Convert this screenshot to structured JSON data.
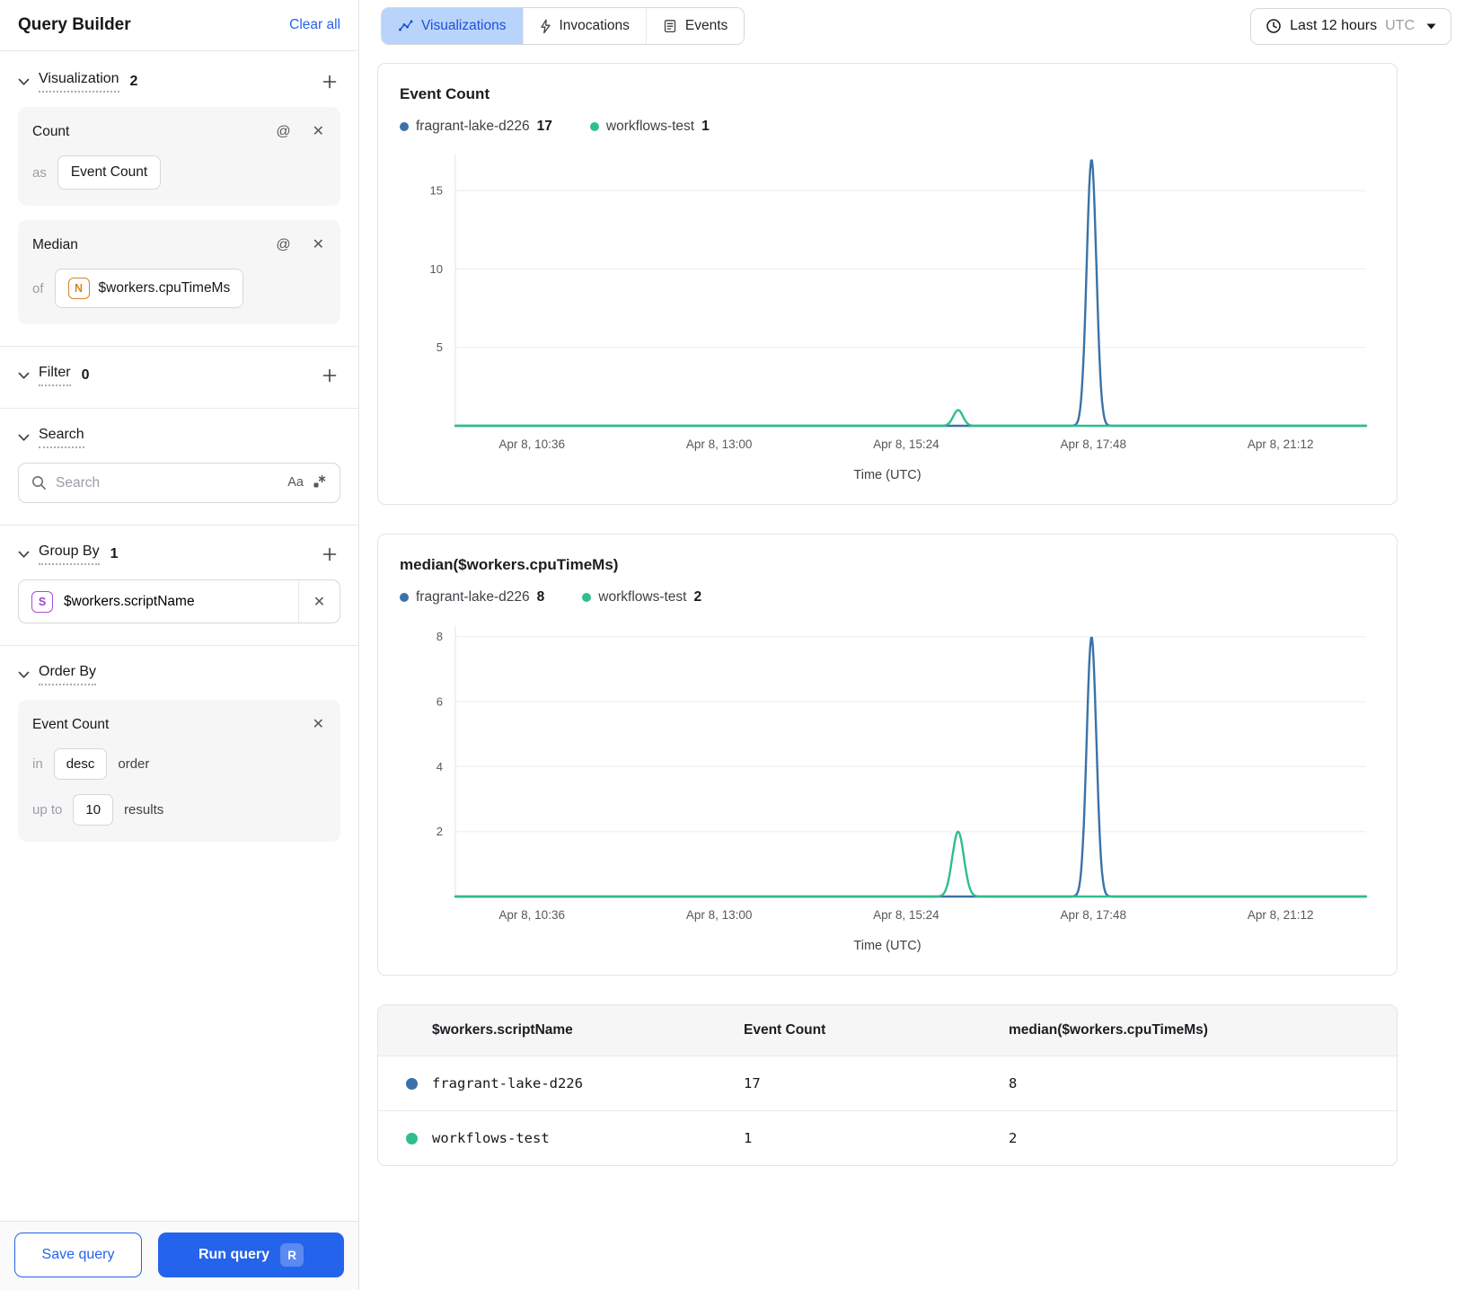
{
  "theme": {
    "accent_blue": "#2463EB",
    "active_tab_bg": "#B9D4FA",
    "active_tab_text": "#1D4FD7",
    "series_blue": "#3A72A8",
    "series_green": "#2FBE8C"
  },
  "sidebar": {
    "title": "Query Builder",
    "clear_all_label": "Clear all",
    "visualization_section": {
      "label": "Visualization",
      "count": "2"
    },
    "count_card": {
      "title": "Count",
      "as_label": "as",
      "value": "Event Count"
    },
    "median_card": {
      "title": "Median",
      "of_label": "of",
      "badge": "N",
      "value": "$workers.cpuTimeMs"
    },
    "filter_section": {
      "label": "Filter",
      "count": "0"
    },
    "search_section": {
      "label": "Search",
      "placeholder": "Search",
      "case_toggle": "Aa"
    },
    "group_by_section": {
      "label": "Group By",
      "count": "1",
      "item": {
        "badge": "S",
        "value": "$workers.scriptName"
      }
    },
    "order_by_section": {
      "label": "Order By",
      "card": {
        "title": "Event Count",
        "in_label": "in",
        "direction": "desc",
        "order_label": "order",
        "up_to_label": "up to",
        "limit": "10",
        "results_label": "results"
      }
    },
    "save_query_label": "Save query",
    "run_query_label": "Run query",
    "run_query_shortcut": "R"
  },
  "topbar": {
    "tabs": [
      {
        "label": "Visualizations",
        "icon": "trend-icon",
        "active": true
      },
      {
        "label": "Invocations",
        "icon": "bolt-icon",
        "active": false
      },
      {
        "label": "Events",
        "icon": "document-icon",
        "active": false
      }
    ],
    "time_range": {
      "label": "Last 12 hours",
      "timezone": "UTC"
    }
  },
  "chart_data": [
    {
      "type": "line",
      "title": "Event Count",
      "xlabel": "Time (UTC)",
      "x_ticks": [
        "Apr 8, 10:36",
        "Apr 8, 13:00",
        "Apr 8, 15:24",
        "Apr 8, 17:48",
        "Apr 8, 21:12"
      ],
      "x_tick_fractions": [
        0.084,
        0.2895,
        0.495,
        0.7005,
        0.906
      ],
      "y_ticks": [
        5,
        10,
        15
      ],
      "ylim": [
        0,
        17.3
      ],
      "grid": true,
      "legend_position": "top",
      "series": [
        {
          "name": "fragrant-lake-d226",
          "legend_value": "17",
          "color": "#3A72A8",
          "baseline": 0,
          "spikes": [
            {
              "x_fraction": 0.6985,
              "peak": 17,
              "sigma": 0.0075
            }
          ]
        },
        {
          "name": "workflows-test",
          "legend_value": "1",
          "color": "#2FBE8C",
          "baseline": 0,
          "spikes": [
            {
              "x_fraction": 0.552,
              "peak": 1,
              "sigma": 0.0075
            }
          ]
        }
      ]
    },
    {
      "type": "line",
      "title": "median($workers.cpuTimeMs)",
      "xlabel": "Time (UTC)",
      "x_ticks": [
        "Apr 8, 10:36",
        "Apr 8, 13:00",
        "Apr 8, 15:24",
        "Apr 8, 17:48",
        "Apr 8, 21:12"
      ],
      "x_tick_fractions": [
        0.084,
        0.2895,
        0.495,
        0.7005,
        0.906
      ],
      "y_ticks": [
        2,
        4,
        6,
        8
      ],
      "ylim": [
        0,
        8.35
      ],
      "grid": true,
      "legend_position": "top",
      "series": [
        {
          "name": "fragrant-lake-d226",
          "legend_value": "8",
          "color": "#3A72A8",
          "baseline": 0,
          "spikes": [
            {
              "x_fraction": 0.6985,
              "peak": 8,
              "sigma": 0.0075
            }
          ]
        },
        {
          "name": "workflows-test",
          "legend_value": "2",
          "color": "#2FBE8C",
          "baseline": 0,
          "spikes": [
            {
              "x_fraction": 0.552,
              "peak": 2,
              "sigma": 0.009
            }
          ]
        }
      ]
    }
  ],
  "table": {
    "columns": [
      "$workers.scriptName",
      "Event Count",
      "median($workers.cpuTimeMs)"
    ],
    "rows": [
      {
        "color": "#3A72A8",
        "name": "fragrant-lake-d226",
        "event_count": "17",
        "median": "8"
      },
      {
        "color": "#2FBE8C",
        "name": "workflows-test",
        "event_count": "1",
        "median": "2"
      }
    ]
  }
}
